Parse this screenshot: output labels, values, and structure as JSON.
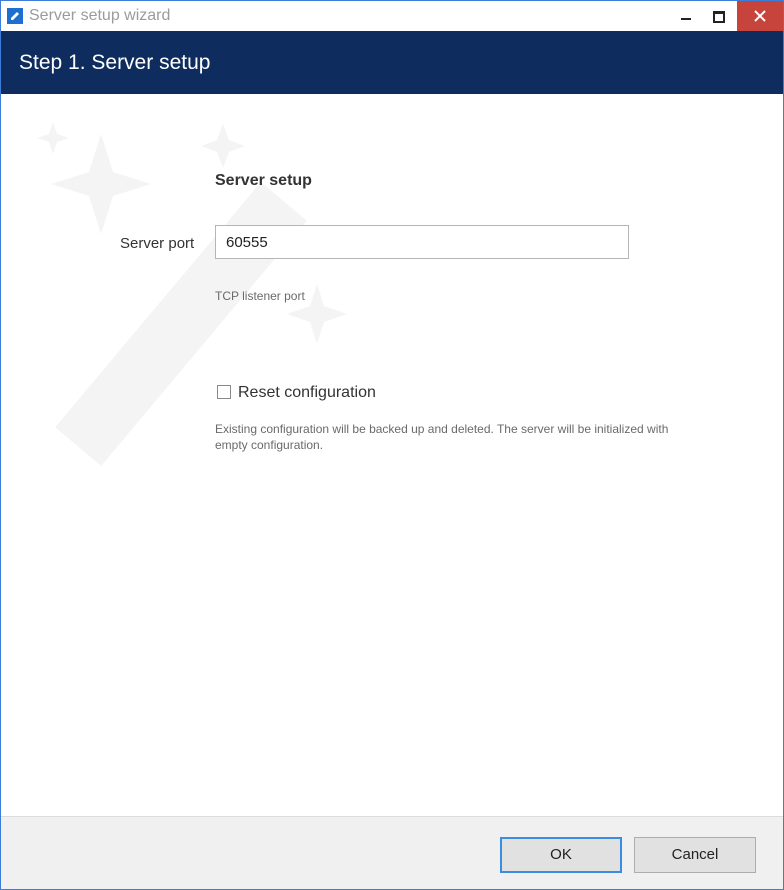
{
  "window": {
    "title": "Server setup wizard",
    "controls": {
      "minimize": "minimize-icon",
      "maximize": "maximize-icon",
      "close": "close-icon"
    }
  },
  "header": {
    "title": "Step 1. Server setup"
  },
  "form": {
    "section_title": "Server setup",
    "server_port": {
      "label": "Server port",
      "value": "60555",
      "hint": "TCP listener port"
    },
    "reset": {
      "label": "Reset configuration",
      "checked": false,
      "hint": "Existing configuration will be backed up and deleted. The server will be initialized with empty configuration."
    }
  },
  "footer": {
    "ok_label": "OK",
    "cancel_label": "Cancel"
  },
  "colors": {
    "header_bg": "#0e2d5e",
    "close_button": "#c7443c",
    "ok_border": "#3a8de0",
    "app_icon": "#1f6fd1"
  }
}
